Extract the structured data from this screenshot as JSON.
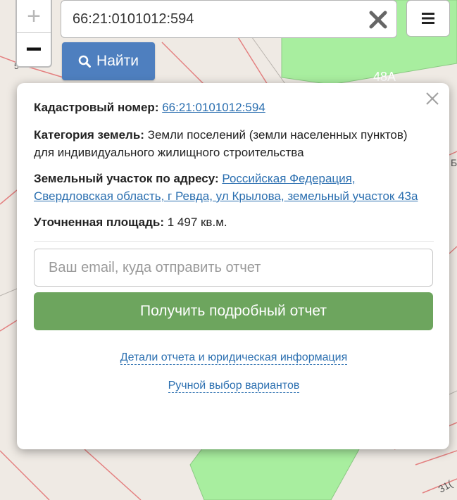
{
  "map": {
    "parcel_labels": [
      "48А",
      "31(",
      "5",
      "Б"
    ],
    "colors": {
      "background": "#efeae4",
      "parcel_green": "#a8ee9f",
      "boundary_red": "#e48080"
    }
  },
  "controls": {
    "zoom_in_label": "+",
    "zoom_out_label": "−",
    "search_value": "66:21:0101012:594",
    "clear_icon": "close-icon",
    "menu_icon": "menu-icon",
    "find_label": "Найти",
    "find_icon": "search-icon"
  },
  "popup": {
    "cadastral_label": "Кадастровый номер:",
    "cadastral_value": "66:21:0101012:594",
    "category_label": "Категория земель:",
    "category_value": "Земли поселений (земли населенных пунктов)",
    "permitted_use": "для индивидуального жилищного строительства",
    "address_label": "Земельный участок по адресу:",
    "address_value": "Российская Федерация, Свердловская область, г Ревда, ул Крылова, земельный участок 43а",
    "area_label": "Уточненная площадь:",
    "area_value": "1 497 кв.м.",
    "email_placeholder": "Ваш email, куда отправить отчет",
    "report_button": "Получить подробный отчет",
    "details_link": "Детали отчета и юридическая информация",
    "manual_link": "Ручной выбор вариантов",
    "close_icon": "close-icon"
  }
}
